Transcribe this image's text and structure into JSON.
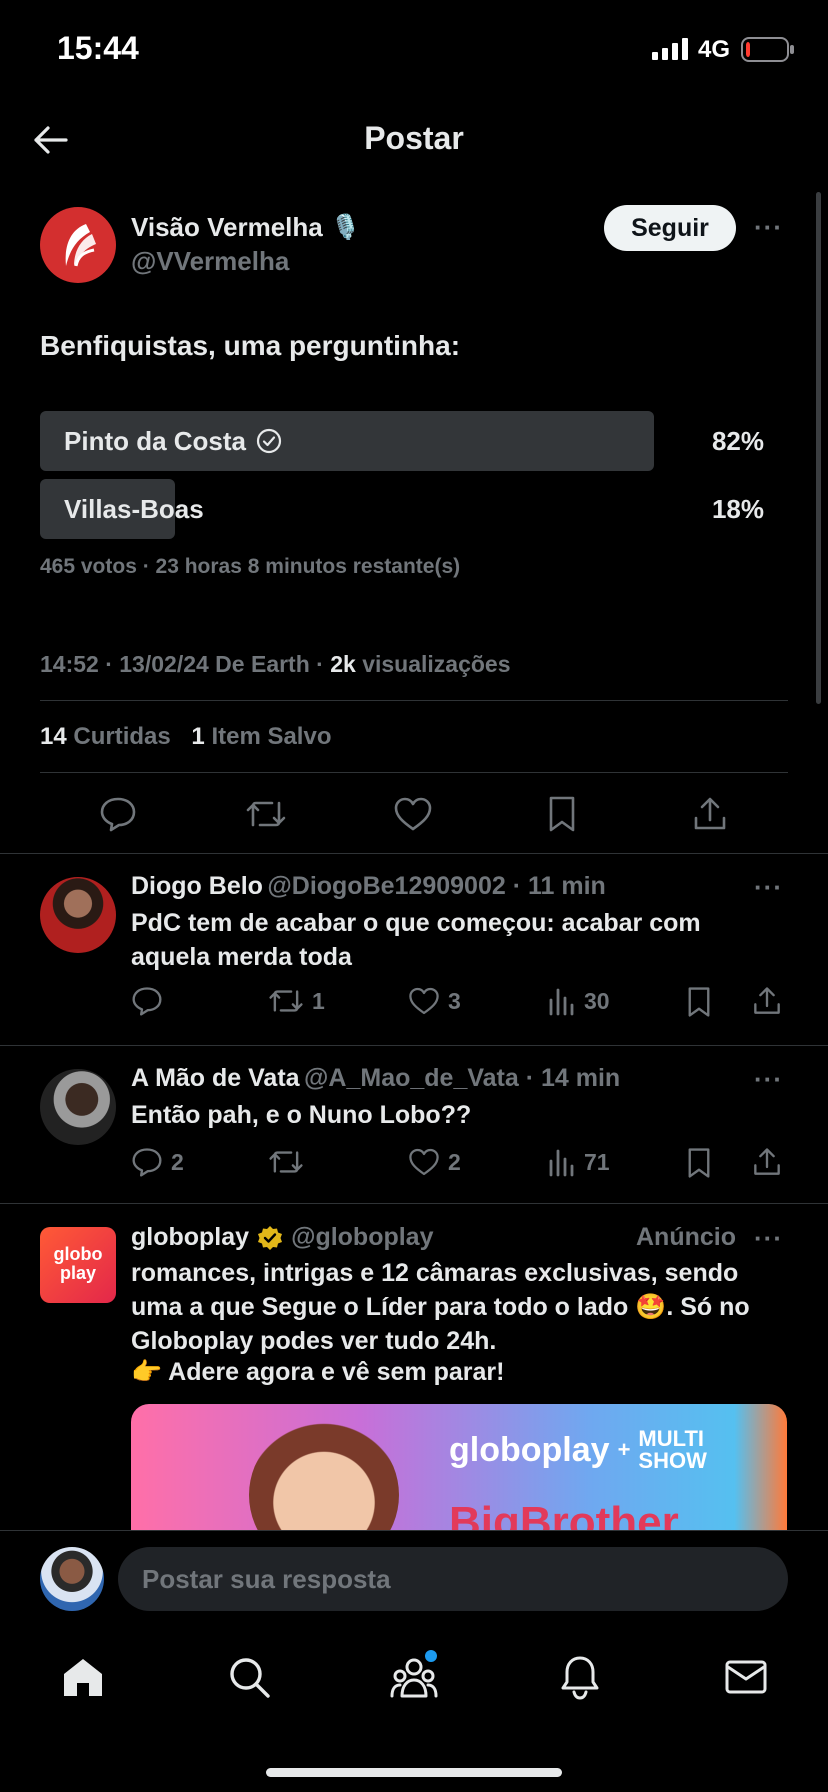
{
  "status_bar": {
    "time": "15:44",
    "network": "4G",
    "battery_level": 0.1
  },
  "header": {
    "title": "Postar",
    "back_icon": "arrow-left-icon"
  },
  "post": {
    "author_name": "Visão Vermelha",
    "author_emoji": "🎙️",
    "handle": "@VVermelha",
    "follow_label": "Seguir",
    "text": "Benfiquistas, uma perguntinha:",
    "poll": {
      "options": [
        {
          "label": "Pinto da Costa",
          "percent_label": "82%",
          "fraction": 0.82,
          "winner": true
        },
        {
          "label": "Villas-Boas",
          "percent_label": "18%",
          "fraction": 0.18,
          "winner": false
        }
      ],
      "summary": "465 votos · 23 horas 8 minutos restante(s)"
    },
    "meta_time": "14:52 · 13/02/24 De Earth · ",
    "meta_views_count": "2k",
    "meta_views_label": " visualizações",
    "likes_count": "14",
    "likes_label": "Curtidas",
    "saved_count": "1",
    "saved_label": "Item Salvo"
  },
  "replies": [
    {
      "name": "Diogo Belo",
      "handle": "@DiogoBe12909002 · 11 min",
      "text": "PdC tem de acabar o que começou: acabar com aquela merda toda",
      "replies": "",
      "retweets": "1",
      "likes": "3",
      "views": "30"
    },
    {
      "name": "A Mão de Vata",
      "handle": "@A_Mao_de_Vata · 14 min",
      "text": "Então pah, e o Nuno Lobo??",
      "replies": "2",
      "retweets": "",
      "likes": "2",
      "views": "71"
    }
  ],
  "ad": {
    "name": "globoplay",
    "handle": "@globoplay",
    "label": "Anúncio",
    "avatar_text_top": "globo",
    "avatar_text_bottom": "play",
    "text": "romances, intrigas e 12 câmaras exclusivas, sendo uma a que Segue o Líder para todo o lado 🤩. Só no Globoplay podes ver tudo 24h.",
    "text2": "👉 Adere agora e vê sem parar!",
    "banner_brand": "globoplay",
    "banner_partner_top": "MULTI",
    "banner_partner_bottom": "SHOW",
    "banner_partial": "BigBrother"
  },
  "composer": {
    "placeholder": "Postar sua resposta"
  },
  "tab_bar": {
    "icons": [
      "home-icon",
      "search-icon",
      "communities-icon",
      "notifications-icon",
      "messages-icon"
    ]
  },
  "colors": {
    "accent": "#1d9bf0",
    "verified_gold": "#e2b719",
    "battery_low": "#ff3b30",
    "brand_red": "#d32f2f"
  }
}
